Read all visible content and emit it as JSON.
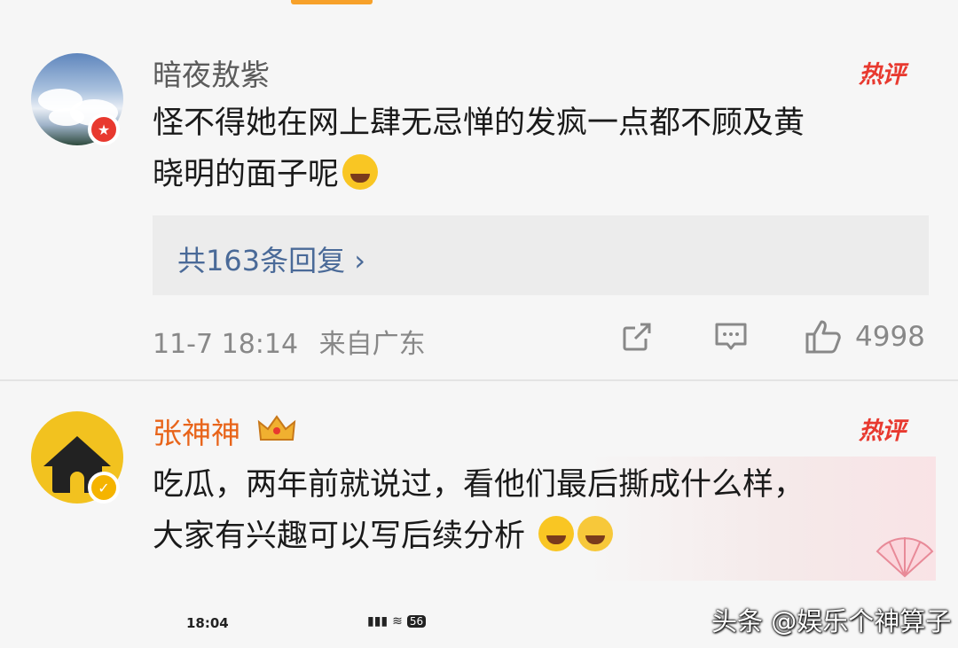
{
  "comments": [
    {
      "username": "暗夜敖紫",
      "hot_label": "热评",
      "text": "怪不得她在网上肆无忌惮的发疯一点都不顾及黄\n晓明的面子呢",
      "emoji": "laughing-tears",
      "replies": "共163条回复",
      "timestamp": "11-7 18:14",
      "location": "来自广东",
      "like_count": "4998"
    },
    {
      "username": "张神神",
      "hot_label": "热评",
      "text": "吃瓜，两年前就说过，看他们最后撕成什么样，\n大家有兴趣可以写后续分析 ",
      "emojis": [
        "grinning",
        "yummy"
      ]
    }
  ],
  "status_bar": {
    "time": "18:04",
    "battery": "56"
  },
  "watermark": "头条 @娱乐个神算子",
  "colors": {
    "accent_orange": "#e8641a",
    "hot_red": "#e8392f",
    "link_blue": "#4a6a98"
  }
}
